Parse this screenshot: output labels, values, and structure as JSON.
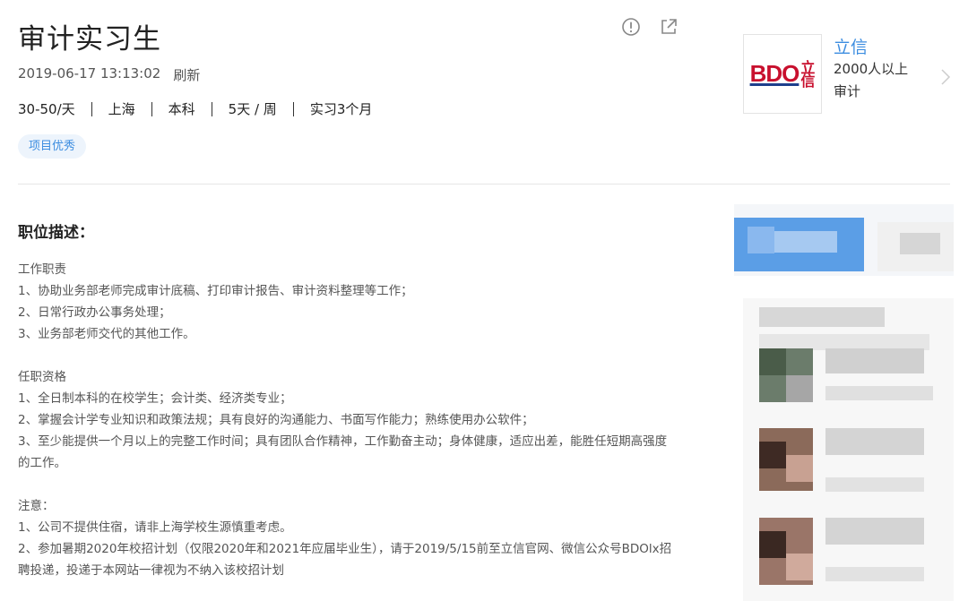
{
  "job": {
    "title": "审计实习生",
    "date": "2019-06-17 13:13:02",
    "refresh_label": "刷新",
    "specs": [
      "30-50/天",
      "上海",
      "本科",
      "5天 / 周",
      "实习3个月"
    ],
    "badge": "项目优秀"
  },
  "icons": {
    "report": "exclamation-circle-icon",
    "share": "share-icon",
    "chevron": "chevron-right-icon"
  },
  "company": {
    "logo_text": "BDO",
    "logo_cn": "立信",
    "name": "立信",
    "size": "2000人以上",
    "industry": "审计"
  },
  "description": {
    "title": "职位描述：",
    "duties_heading": "工作职责",
    "duties": [
      " 1、协助业务部老师完成审计底稿、打印审计报告、审计资料整理等工作；",
      " 2、日常行政办公事务处理；",
      " 3、业务部老师交代的其他工作。"
    ],
    "requirements_heading": "任职资格",
    "requirements": [
      " 1、全日制本科的在校学生；会计类、经济类专业；",
      " 2、掌握会计学专业知识和政策法规；具有良好的沟通能力、书面写作能力；熟练使用办公软件；",
      " 3、至少能提供一个月以上的完整工作时间；具有团队合作精神，工作勤奋主动；身体健康，适应出差，能胜任短期高强度的工作。"
    ],
    "notes_heading": "注意：",
    "notes": [
      "1、公司不提供住宿，请非上海学校生源慎重考虑。",
      "2、参加暑期2020年校招计划（仅限2020年和2021年应届毕业生），请于2019/5/15前至立信官网、微信公众号BDOlx招聘投递，投递于本网站一律视为不纳入该校招计划"
    ]
  },
  "colors": {
    "accent": "#3c8de0",
    "badge_bg": "#edf4fc",
    "logo_red": "#c8102e",
    "logo_blue": "#1d3f8c"
  }
}
